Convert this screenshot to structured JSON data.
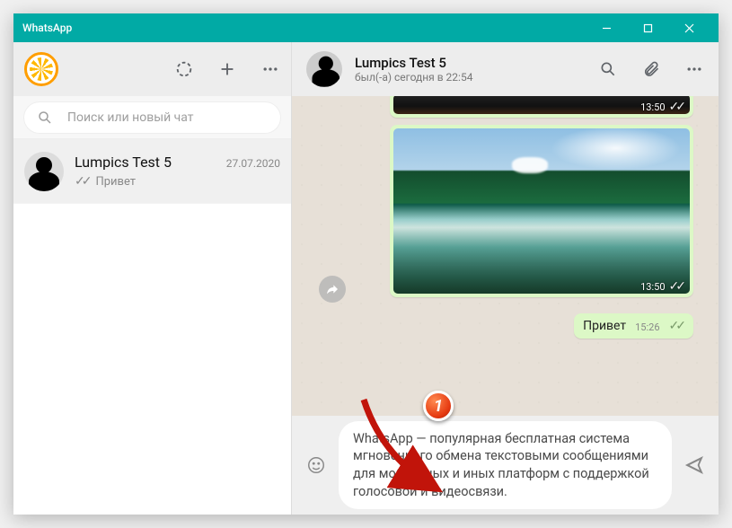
{
  "window": {
    "title": "WhatsApp"
  },
  "left_header": {
    "status_icon": "status",
    "new_icon": "new-chat",
    "menu_icon": "menu"
  },
  "search": {
    "placeholder": "Поиск или новый чат"
  },
  "chats": [
    {
      "name": "Lumpics Test 5",
      "date": "27.07.2020",
      "preview": "Привет",
      "read": true
    }
  ],
  "conversation": {
    "name": "Lumpics Test 5",
    "status": "был(-а) сегодня в 22:54",
    "messages": {
      "media1_time": "13:50",
      "media2_time": "13:50",
      "text1": "Привет",
      "text1_time": "15:26"
    }
  },
  "composer": {
    "text": "WhatsApp — популярная бесплатная система мгновенного обмена текстовыми сообщениями для мобильных и иных платформ с поддержкой голосовой и видеосвязи."
  },
  "annotation": {
    "badge": "1"
  }
}
